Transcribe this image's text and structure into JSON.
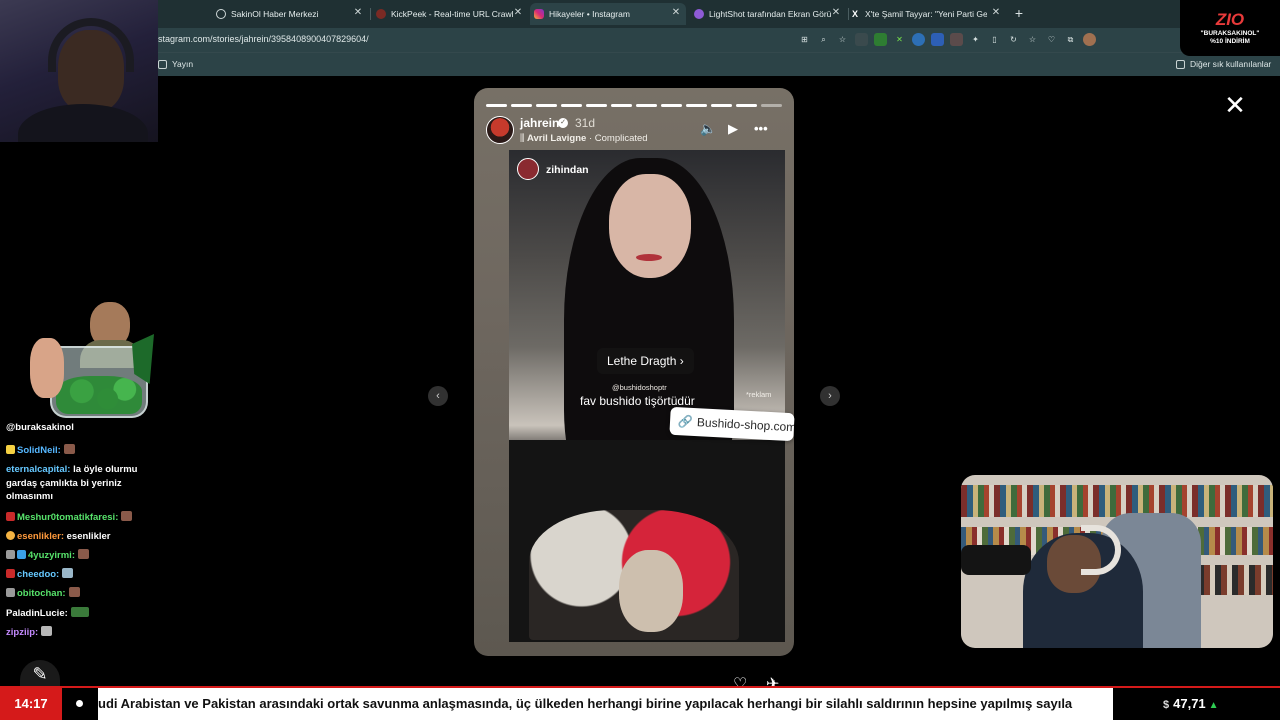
{
  "browser": {
    "tabs": [
      {
        "title": "SakinOl Haber Merkezi",
        "icon": "globe-icon"
      },
      {
        "title": "KickPeek - Real-time URL Crawler",
        "icon": "kickpeek-icon"
      },
      {
        "title": "Hikayeler • Instagram",
        "icon": "instagram-icon"
      },
      {
        "title": "LightShot tarafından Ekran Görün",
        "icon": "lightshot-icon"
      },
      {
        "title": "X'te Şamil Tayyar: \"Yeni Parti Genel",
        "icon": "x-icon"
      }
    ],
    "url": "stagram.com/stories/jahrein/3958408900407829604/",
    "bookmarks": {
      "left": "Yayın",
      "right": "Diğer sık kullanılanlar"
    }
  },
  "sponsor": {
    "logo": "ZIO",
    "line1": "\"BURAKSAKINOL\"",
    "line2": "%10 İNDİRİM"
  },
  "chat": {
    "handle": "@buraksakinol",
    "messages": [
      {
        "user": "SolidNeil:",
        "text": "",
        "color": "#56b7ff"
      },
      {
        "user": "eternalcapital:",
        "text": "la öyle olurmu gardaş çamlıkta bi yeriniz olmasınmı",
        "color": "#66c8ff"
      },
      {
        "user": "Meshur0tomatikfaresi:",
        "text": "",
        "color": "#57e36b"
      },
      {
        "user": "esenlikler:",
        "text": "esenlikler",
        "color": "#ff9a3c"
      },
      {
        "user": "4yuzyirmi:",
        "text": "",
        "color": "#57e36b"
      },
      {
        "user": "cheedoo:",
        "text": "",
        "color": "#66c8ff"
      },
      {
        "user": "obitochan:",
        "text": "",
        "color": "#57e36b"
      },
      {
        "user": "PaladinLucie:",
        "text": "",
        "color": "#ffffff"
      },
      {
        "user": "zipziip:",
        "text": "",
        "color": "#c58bff"
      }
    ]
  },
  "story": {
    "username": "jahrein",
    "time": "31d",
    "artist": "Avril Lavigne",
    "song": "Complicated",
    "inner_username": "zihindan",
    "mention": "Lethe Dragth",
    "small_caption": "@bushidoshoptr",
    "caption": "fav bushido tişörtüdür",
    "ad_label": "*reklam",
    "link_text": "Bushido-shop.com"
  },
  "ticker": {
    "time": "14:17",
    "headline": "udi Arabistan ve Pakistan arasındaki ortak savunma anlaşmasında, üç ülkeden herhangi birine yapılacak herhangi bir silahlı saldırının hepsine yapılmış sayıla",
    "currency_symbol": "$",
    "price": "47,71"
  }
}
